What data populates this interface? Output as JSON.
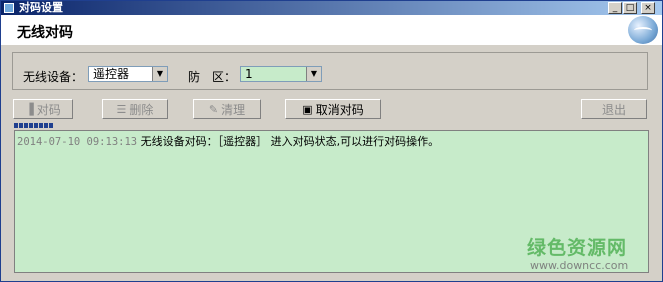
{
  "window": {
    "title": "对码设置",
    "controls": {
      "minimize": "_",
      "maximize": "□",
      "close": "×"
    }
  },
  "header": {
    "title": "无线对码"
  },
  "form": {
    "device_label": "无线设备：",
    "device_value": "遥控器",
    "zone_label": "防　区：",
    "zone_value": "1"
  },
  "toolbar": {
    "pair_label": "对码",
    "delete_label": "删除",
    "clear_label": "清理",
    "cancel_pair_label": "取消对码",
    "exit_label": "退出"
  },
  "log": {
    "entries": [
      {
        "time": "2014-07-10 09:13:13",
        "message": "无线设备对码：［遥控器］ 进入对码状态,可以进行对码操作。"
      }
    ]
  },
  "watermark": {
    "text": "绿色资源网",
    "url": "www.downcc.com"
  },
  "colors": {
    "log_bg": "#c7ebca",
    "title_bar": "#0a246a",
    "progress": "#1f3f8f"
  },
  "icons": {
    "window": "app-icon",
    "logo": "globe-icon"
  }
}
